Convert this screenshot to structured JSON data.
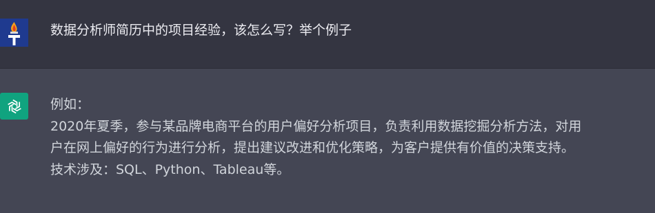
{
  "user_message": {
    "avatar_icon": "torch-flame-icon",
    "text": "数据分析师简历中的项目经验，该怎么写？举个例子"
  },
  "assistant_message": {
    "avatar_icon": "openai-logo-icon",
    "lines": [
      "例如：",
      "2020年夏季，参与某品牌电商平台的用户偏好分析项目，负责利用数据挖掘分析方法，对用",
      "户在网上偏好的行为进行分析，提出建议改进和优化策略，为客户提供有价值的决策支持。",
      "技术涉及：SQL、Python、Tableau等。"
    ]
  },
  "colors": {
    "user_bg": "#343541",
    "assistant_bg": "#444654",
    "bot_avatar": "#10a37f",
    "user_avatar": "#1f3a8f"
  }
}
